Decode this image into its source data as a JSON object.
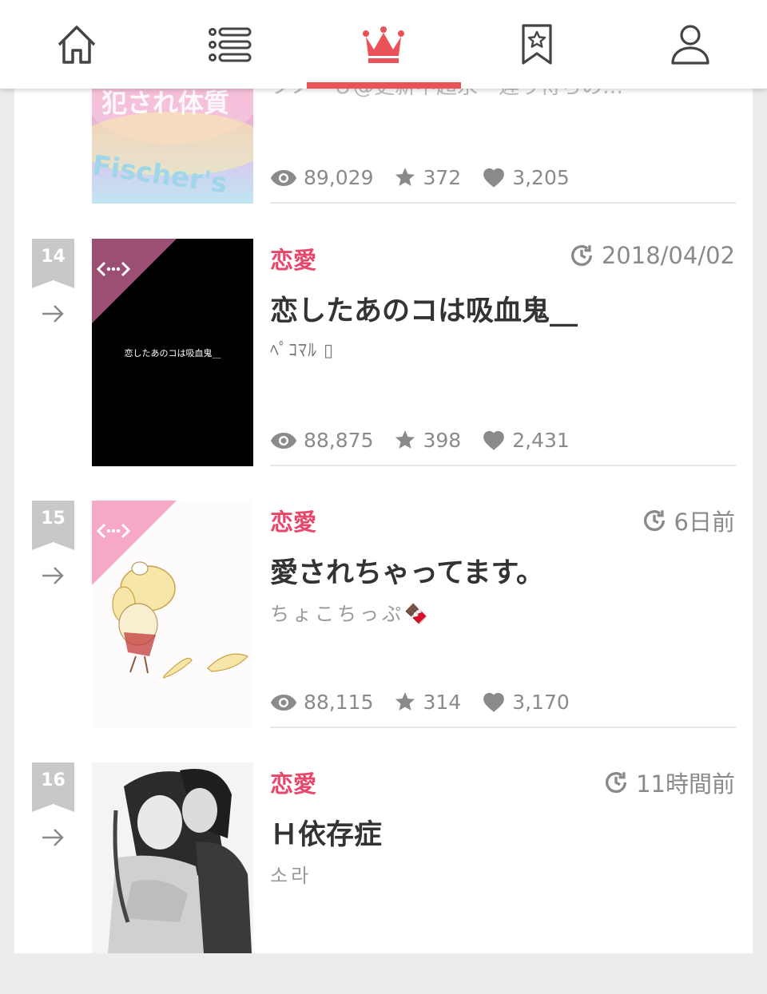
{
  "colors": {
    "accent": "#e95258",
    "genre": "#e8466a",
    "meta": "#8a8a8a"
  },
  "nav": [
    {
      "name": "home-icon",
      "active": false
    },
    {
      "name": "list-icon",
      "active": false
    },
    {
      "name": "crown-icon",
      "active": true
    },
    {
      "name": "bookmark-star-icon",
      "active": false
    },
    {
      "name": "user-icon",
      "active": false
    }
  ],
  "partial_item": {
    "title_fragment": "フノ＝Ｕ@更新中超永・遅り待ちの…",
    "thumb_text_1": "犯され体質",
    "thumb_text_2": "Fischer's",
    "views": "89,029",
    "stars": "372",
    "likes": "3,205"
  },
  "items": [
    {
      "rank": "14",
      "genre": "恋愛",
      "date": "2018/04/02",
      "title": "恋したあのコは吸血鬼__",
      "author": "ﾍﾟｺﾏﾙ ▯",
      "thumb_caption": "恋したあのコは吸血鬼__",
      "views": "88,875",
      "stars": "398",
      "likes": "2,431"
    },
    {
      "rank": "15",
      "genre": "恋愛",
      "date": "6日前",
      "title": "愛されちゃってます。",
      "author": "ちょこちっぷ🍫",
      "thumb_caption": "",
      "views": "88,115",
      "stars": "314",
      "likes": "3,170"
    },
    {
      "rank": "16",
      "genre": "恋愛",
      "date": "11時間前",
      "title": "Ｈ依存症",
      "author": "소라",
      "thumb_caption": ""
    }
  ]
}
